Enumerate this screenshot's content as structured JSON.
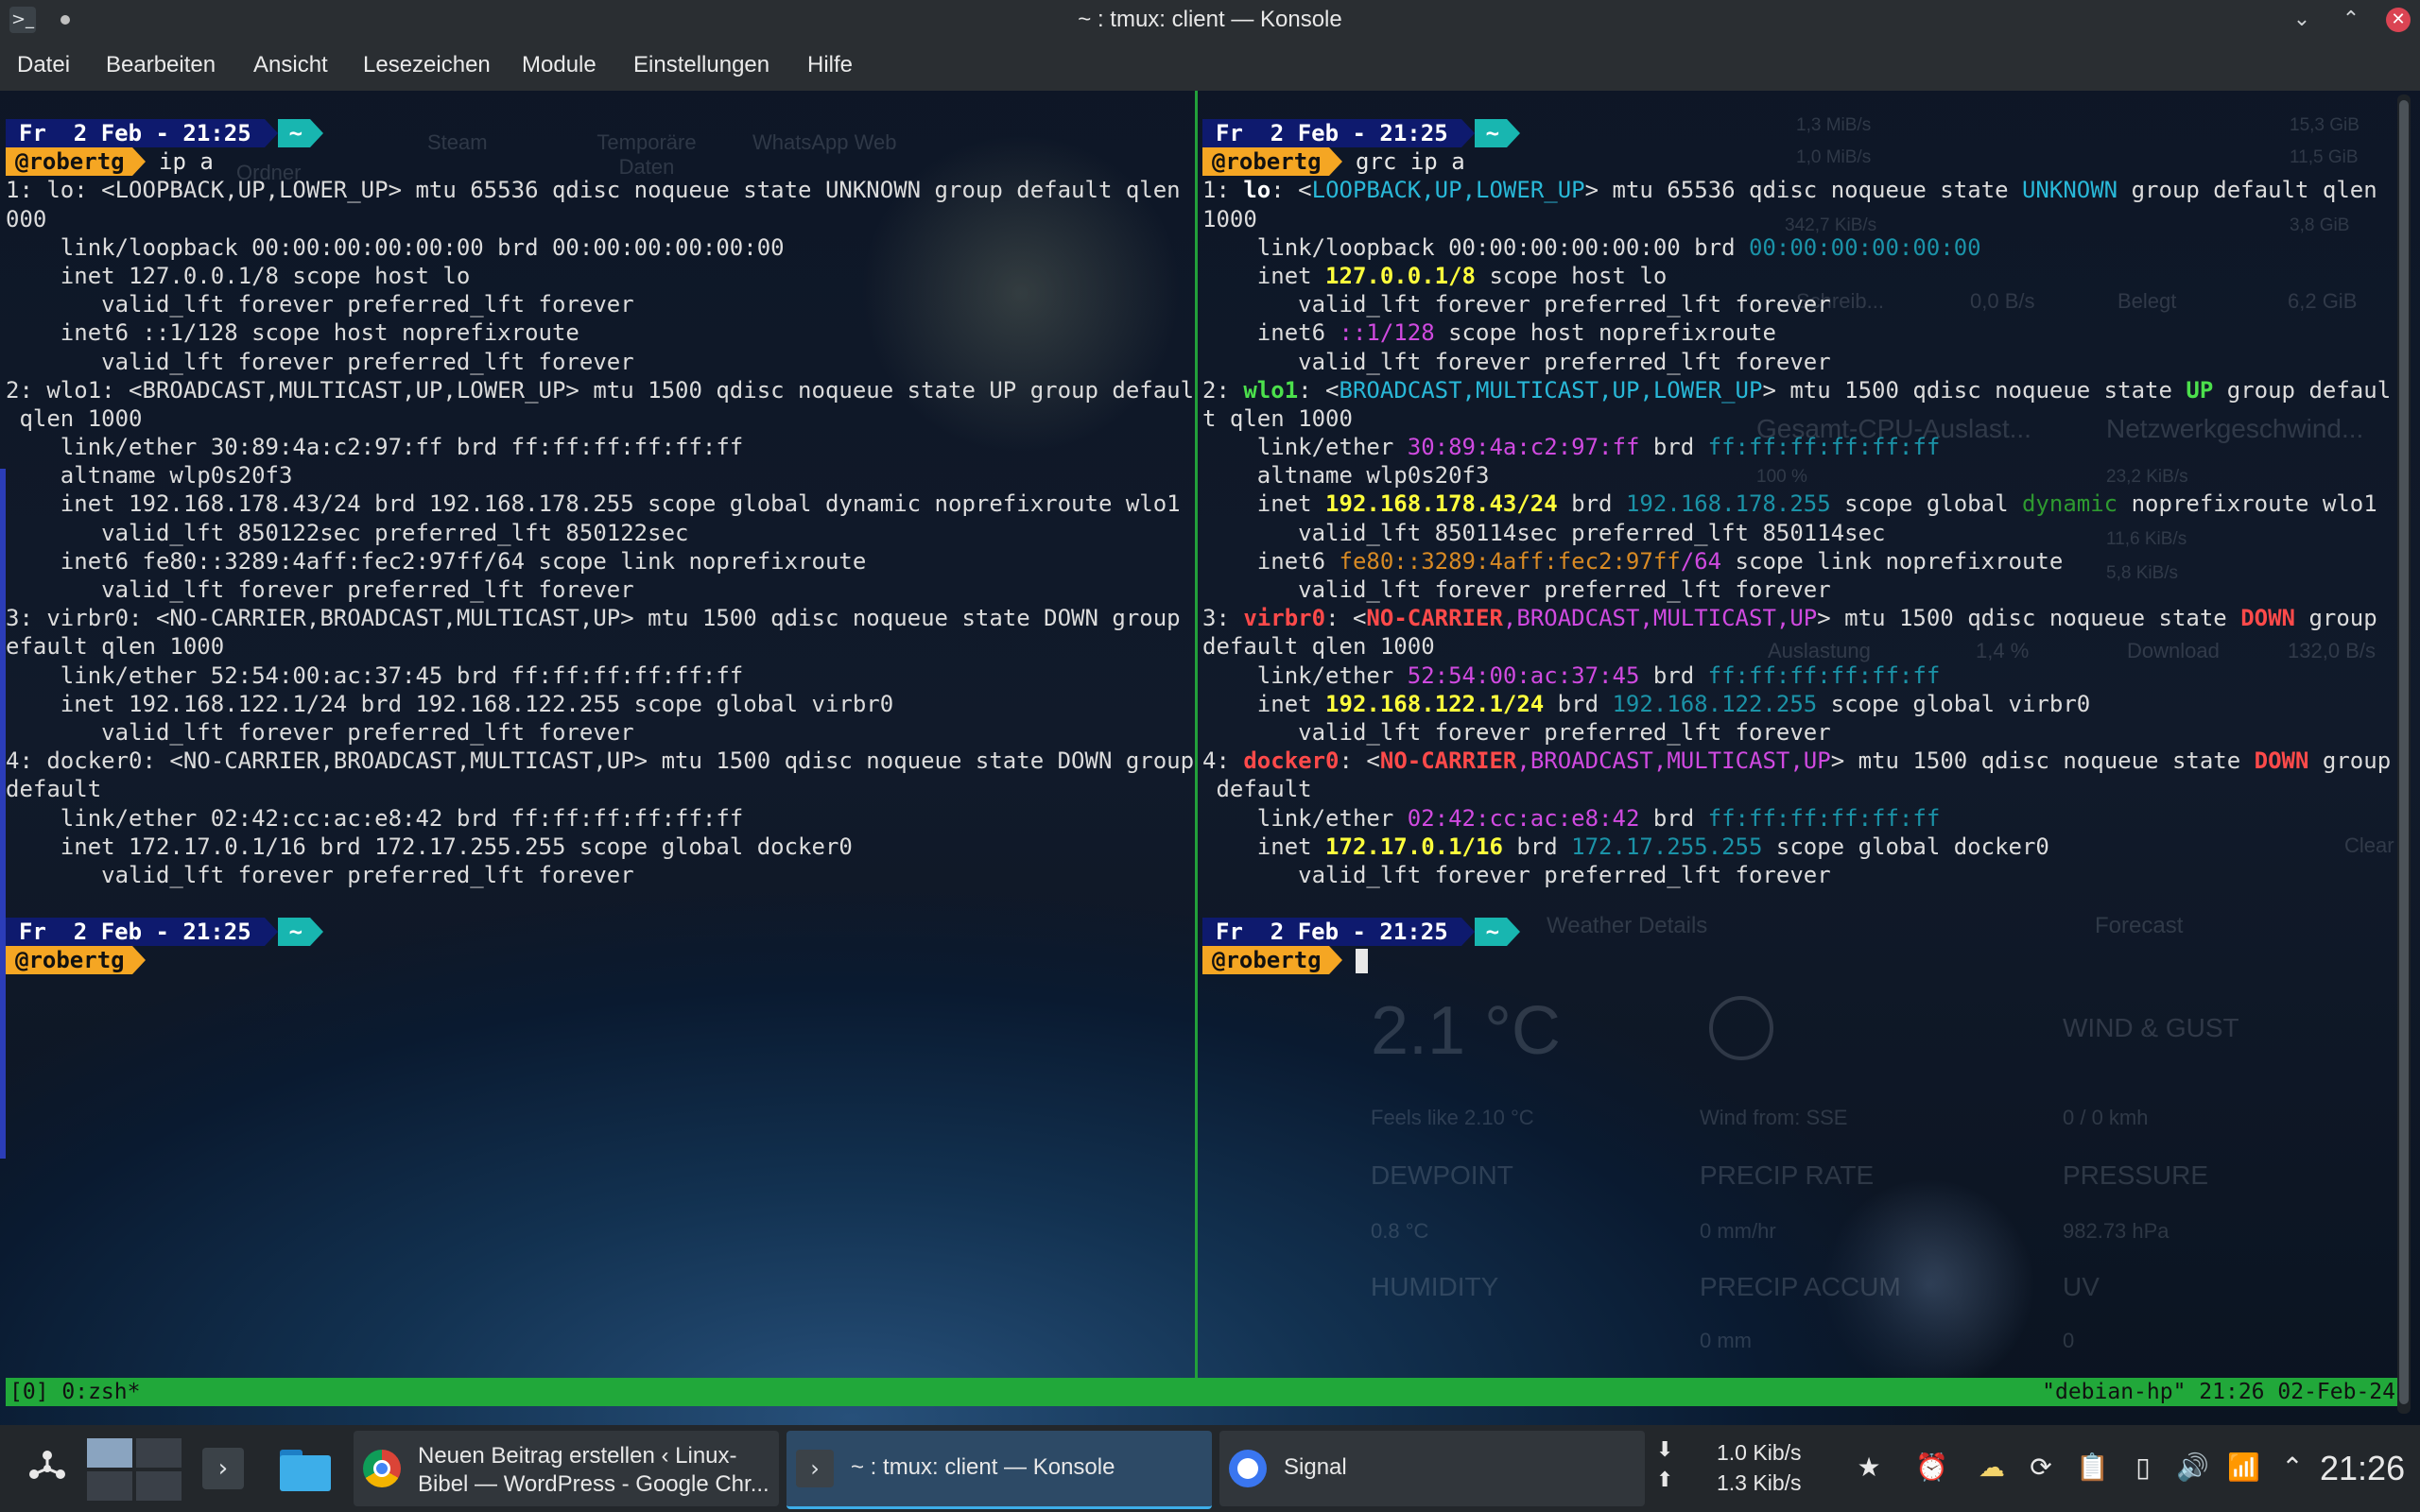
{
  "window": {
    "title": "~ : tmux: client — Konsole",
    "minimize": "⌄",
    "maximize": "⌃",
    "close": "✕",
    "app_glyph": ">_"
  },
  "menu": [
    "Datei",
    "Bearbeiten",
    "Ansicht",
    "Lesezeichen",
    "Module",
    "Einstellungen",
    "Hilfe"
  ],
  "prompt": {
    "day": "Fr  2 Feb - 21:25",
    "dir": "~",
    "user": "@robertg"
  },
  "left_pane": {
    "command": "ip a",
    "output": [
      "1: lo: <LOOPBACK,UP,LOWER_UP> mtu 65536 qdisc noqueue state UNKNOWN group default qlen 1",
      "000",
      "    link/loopback 00:00:00:00:00:00 brd 00:00:00:00:00:00",
      "    inet 127.0.0.1/8 scope host lo",
      "       valid_lft forever preferred_lft forever",
      "    inet6 ::1/128 scope host noprefixroute",
      "       valid_lft forever preferred_lft forever",
      "2: wlo1: <BROADCAST,MULTICAST,UP,LOWER_UP> mtu 1500 qdisc noqueue state UP group default",
      " qlen 1000",
      "    link/ether 30:89:4a:c2:97:ff brd ff:ff:ff:ff:ff:ff",
      "    altname wlp0s20f3",
      "    inet 192.168.178.43/24 brd 192.168.178.255 scope global dynamic noprefixroute wlo1",
      "       valid_lft 850122sec preferred_lft 850122sec",
      "    inet6 fe80::3289:4aff:fec2:97ff/64 scope link noprefixroute",
      "       valid_lft forever preferred_lft forever",
      "3: virbr0: <NO-CARRIER,BROADCAST,MULTICAST,UP> mtu 1500 qdisc noqueue state DOWN group d",
      "efault qlen 1000",
      "    link/ether 52:54:00:ac:37:45 brd ff:ff:ff:ff:ff:ff",
      "    inet 192.168.122.1/24 brd 192.168.122.255 scope global virbr0",
      "       valid_lft forever preferred_lft forever",
      "4: docker0: <NO-CARRIER,BROADCAST,MULTICAST,UP> mtu 1500 qdisc noqueue state DOWN group",
      "default",
      "    link/ether 02:42:cc:ac:e8:42 brd ff:ff:ff:ff:ff:ff",
      "    inet 172.17.0.1/16 brd 172.17.255.255 scope global docker0",
      "       valid_lft forever preferred_lft forever"
    ]
  },
  "right_pane": {
    "command": "grc ip a",
    "output": [
      [
        [
          "1: ",
          ""
        ],
        [
          "lo",
          "gw"
        ],
        [
          ": <",
          ""
        ],
        [
          "LOOPBACK,UP,LOWER_UP",
          "gc"
        ],
        [
          "> mtu 65536 qdisc noqueue state ",
          ""
        ],
        [
          "UNKNOWN",
          "gc"
        ],
        [
          " group default qlen",
          ""
        ]
      ],
      [
        [
          "1000",
          ""
        ]
      ],
      [
        [
          "    link/loopback 00:00:00:00:00:00 brd ",
          ""
        ],
        [
          "00:00:00:00:00:00",
          "gb"
        ]
      ],
      [
        [
          "    inet ",
          ""
        ],
        [
          "127.0.0.1/8",
          "gy"
        ],
        [
          " scope host lo",
          ""
        ]
      ],
      [
        [
          "       valid_lft forever preferred_lft forever",
          ""
        ]
      ],
      [
        [
          "    inet6 ",
          ""
        ],
        [
          "::1",
          "gm"
        ],
        [
          "/128",
          "gm"
        ],
        [
          " scope host noprefixroute",
          ""
        ]
      ],
      [
        [
          "       valid_lft forever preferred_lft forever",
          ""
        ]
      ],
      [
        [
          "2: ",
          ""
        ],
        [
          "wlo1",
          "gg"
        ],
        [
          ": <",
          ""
        ],
        [
          "BROADCAST,MULTICAST,UP,LOWER_UP",
          "gc"
        ],
        [
          "> mtu 1500 qdisc noqueue state ",
          ""
        ],
        [
          "UP",
          "gg"
        ],
        [
          " group defaul",
          ""
        ]
      ],
      [
        [
          "t qlen 1000",
          ""
        ]
      ],
      [
        [
          "    link/ether ",
          ""
        ],
        [
          "30:89:4a:c2:97:ff",
          "gm"
        ],
        [
          " brd ",
          ""
        ],
        [
          "ff:ff:ff:ff:ff:ff",
          "gb"
        ]
      ],
      [
        [
          "    altname wlp0s20f3",
          ""
        ]
      ],
      [
        [
          "    inet ",
          ""
        ],
        [
          "192.168.178.43/24",
          "gy"
        ],
        [
          " brd ",
          ""
        ],
        [
          "192.168.178.255",
          "gb"
        ],
        [
          " scope global ",
          ""
        ],
        [
          "dynamic",
          "gd"
        ],
        [
          " noprefixroute wlo1",
          ""
        ]
      ],
      [
        [
          "       valid_lft 850114sec preferred_lft 850114sec",
          ""
        ]
      ],
      [
        [
          "    inet6 ",
          ""
        ],
        [
          "fe80::3289:4aff:fec2:97ff",
          "go"
        ],
        [
          "/64",
          "gm"
        ],
        [
          " scope link noprefixroute",
          ""
        ]
      ],
      [
        [
          "       valid_lft forever preferred_lft forever",
          ""
        ]
      ],
      [
        [
          "3: ",
          ""
        ],
        [
          "virbr0",
          "gr"
        ],
        [
          ": <",
          ""
        ],
        [
          "NO-CARRIER",
          "gr"
        ],
        [
          ",BROADCAST,MULTICAST,UP",
          "gm"
        ],
        [
          "> mtu 1500 qdisc noqueue state ",
          ""
        ],
        [
          "DOWN",
          "gr"
        ],
        [
          " group",
          ""
        ]
      ],
      [
        [
          "default qlen 1000",
          ""
        ]
      ],
      [
        [
          "    link/ether ",
          ""
        ],
        [
          "52:54:00:ac:37:45",
          "gm"
        ],
        [
          " brd ",
          ""
        ],
        [
          "ff:ff:ff:ff:ff:ff",
          "gb"
        ]
      ],
      [
        [
          "    inet ",
          ""
        ],
        [
          "192.168.122.1/24",
          "gy"
        ],
        [
          " brd ",
          ""
        ],
        [
          "192.168.122.255",
          "gb"
        ],
        [
          " scope global virbr0",
          ""
        ]
      ],
      [
        [
          "       valid_lft forever preferred_lft forever",
          ""
        ]
      ],
      [
        [
          "4: ",
          ""
        ],
        [
          "docker0",
          "gr"
        ],
        [
          ": <",
          ""
        ],
        [
          "NO-CARRIER",
          "gr"
        ],
        [
          ",BROADCAST,MULTICAST,UP",
          "gm"
        ],
        [
          "> mtu 1500 qdisc noqueue state ",
          ""
        ],
        [
          "DOWN",
          "gr"
        ],
        [
          " group",
          ""
        ]
      ],
      [
        [
          " default",
          ""
        ]
      ],
      [
        [
          "    link/ether ",
          ""
        ],
        [
          "02:42:cc:ac:e8:42",
          "gm"
        ],
        [
          " brd ",
          ""
        ],
        [
          "ff:ff:ff:ff:ff:ff",
          "gb"
        ]
      ],
      [
        [
          "    inet ",
          ""
        ],
        [
          "172.17.0.1/16",
          "gy"
        ],
        [
          " brd ",
          ""
        ],
        [
          "172.17.255.255",
          "gb"
        ],
        [
          " scope global docker0",
          ""
        ]
      ],
      [
        [
          "       valid_lft forever preferred_lft forever",
          ""
        ]
      ]
    ]
  },
  "tmux": {
    "left": "[0] 0:zsh*",
    "right": "\"debian-hp\" 21:26 02-Feb-24"
  },
  "taskbar": {
    "tasks": [
      {
        "label": "Neuen Beitrag erstellen ‹ Linux-\nBibel — WordPress - Google Chr...",
        "icon": "chrome-icon"
      },
      {
        "label": "~ : tmux: client — Konsole",
        "icon": "konsole-icon"
      },
      {
        "label": "Signal",
        "icon": "signal-icon"
      }
    ],
    "net_down": "1.0 Kib/s",
    "net_up": "1.3 Kib/s",
    "clock": "21:26"
  },
  "colors": {
    "prompt_date_bg": "#0e1a6e",
    "prompt_dir_bg": "#18b6b0",
    "prompt_user_bg": "#f5a623",
    "tmux_status_bg": "#21a83a",
    "titlebar_bg": "#2a2e32",
    "close_button": "#da4453"
  },
  "desktop_widgets": {
    "icons": [
      "Ordner",
      "Steam",
      "Temporäre Daten",
      "WhatsApp Web"
    ],
    "system_monitor": [
      "1,3 MiB/s",
      "1,0 MiB/s",
      "342,7 KiB/s",
      "15,3 GiB",
      "11,5 GiB",
      "3,8 GiB",
      "Schreib...",
      "0,0 B/s",
      "Belegt",
      "6,2 GiB",
      "Gesamt-CPU-Auslast...",
      "Netzwerkgeschwind...",
      "100 %",
      "23,2 KiB/s",
      "11,6 KiB/s",
      "5,8 KiB/s",
      "Auslastung",
      "1,4 %",
      "Download",
      "132,0 B/s"
    ],
    "weather": {
      "details_tab": "Weather Details",
      "forecast_tab": "Forecast",
      "temperature": "2.1 °C",
      "feels_like": "Feels like 2.10 °C",
      "wind_from": "Wind from: SSE",
      "wind_gust_label": "WIND & GUST",
      "wind_gust_value": "0 / 0 kmh",
      "dewpoint_label": "DEWPOINT",
      "dewpoint_value": "0.8 °C",
      "precip_rate_label": "PRECIP RATE",
      "precip_rate_value": "0 mm/hr",
      "pressure_label": "PRESSURE",
      "pressure_value": "982.73 hPa",
      "humidity_label": "HUMIDITY",
      "precip_accum_label": "PRECIP ACCUM",
      "precip_accum_value": "0 mm",
      "uv_label": "UV",
      "uv_value": "0",
      "clear_label": "Clear"
    }
  }
}
